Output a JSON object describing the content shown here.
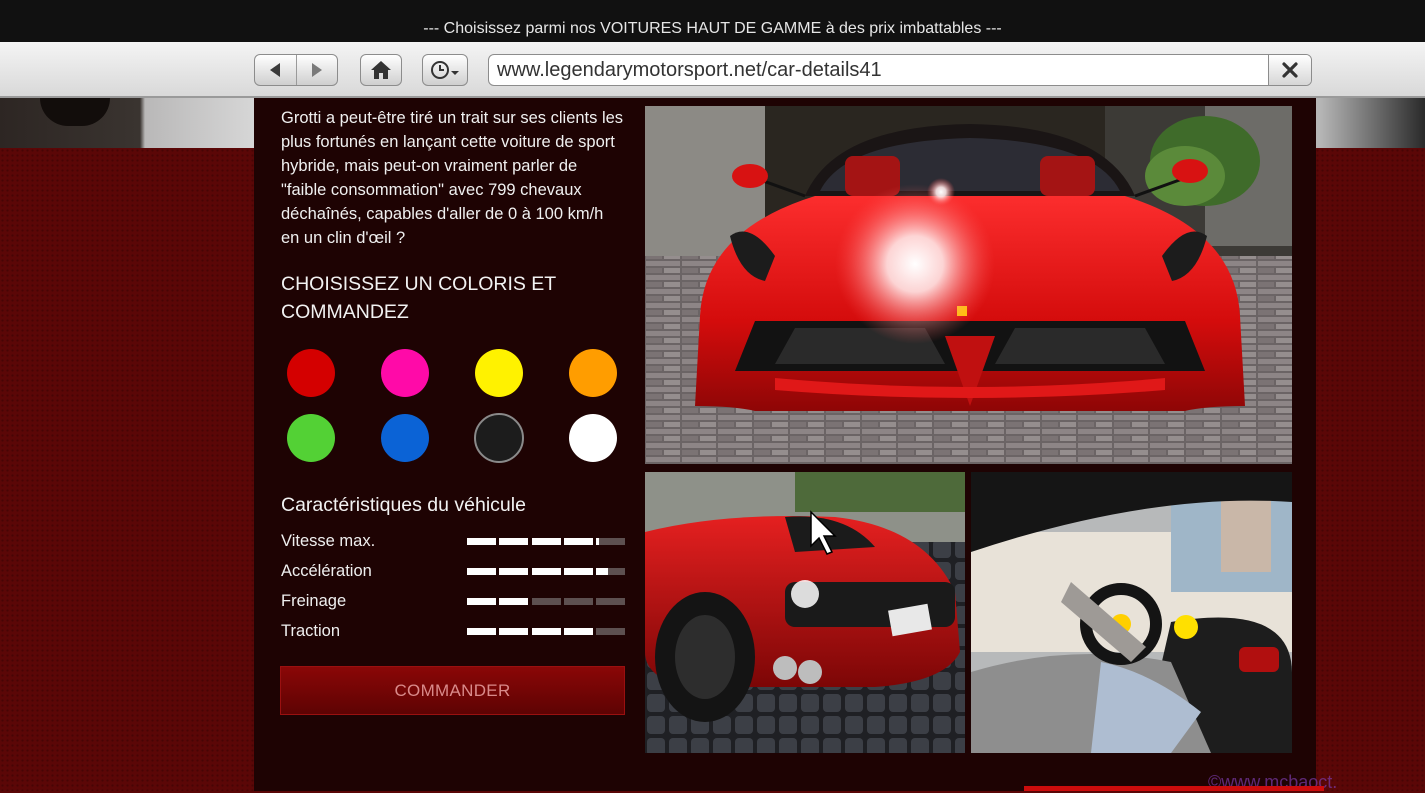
{
  "window": {
    "title": "--- Choisissez parmi nos VOITURES HAUT DE GAMME à des prix imbattables ---"
  },
  "toolbar": {
    "back_icon": "back-arrow-icon",
    "forward_icon": "forward-arrow-icon",
    "home_icon": "home-icon",
    "history_icon": "clock-icon",
    "url": "www.legendarymotorsport.net/car-details41",
    "close_icon": "close-icon"
  },
  "vehicle": {
    "description": "Grotti a peut-être tiré un trait sur ses clients les plus fortunés en lançant cette voiture de sport hybride, mais peut-on vraiment parler de \"faible consommation\" avec 799 chevaux déchaînés, capables d'aller de 0 à 100 km/h en un clin d'œil ?",
    "color_section_title": "CHOISISSEZ UN COLORIS ET COMMANDEZ",
    "colors": [
      "#d40000",
      "#ff0aa8",
      "#fff200",
      "#ff9d00",
      "#53d135",
      "#0b63d6",
      "#1c1c1c",
      "#ffffff"
    ],
    "specs_title": "Caractéristiques du véhicule",
    "specs": [
      {
        "label": "Vitesse max.",
        "value": 0.82
      },
      {
        "label": "Accélération",
        "value": 0.88
      },
      {
        "label": "Freinage",
        "value": 0.4
      },
      {
        "label": "Traction",
        "value": 0.8
      }
    ],
    "order_label": "COMMANDER"
  },
  "watermark": "©www.mcbaoct."
}
